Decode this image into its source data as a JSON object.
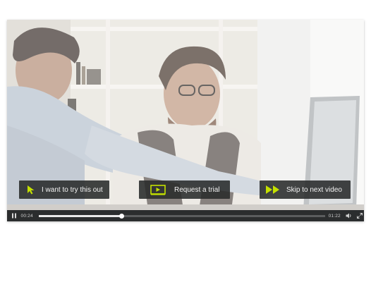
{
  "player": {
    "actions": [
      {
        "label": "I want to try this out",
        "icon": "cursor-arrow-icon"
      },
      {
        "label": "Request a trial",
        "icon": "video-screen-play-icon"
      },
      {
        "label": "Skip to next video",
        "icon": "fast-forward-icon"
      }
    ],
    "accent_color": "#c4e000",
    "controls": {
      "current_time": "00:24",
      "duration": "01:22",
      "progress_fraction": 0.29,
      "play_state_icon": "pause-icon",
      "volume_icon": "volume-icon",
      "fullscreen_icon": "fullscreen-icon"
    }
  }
}
